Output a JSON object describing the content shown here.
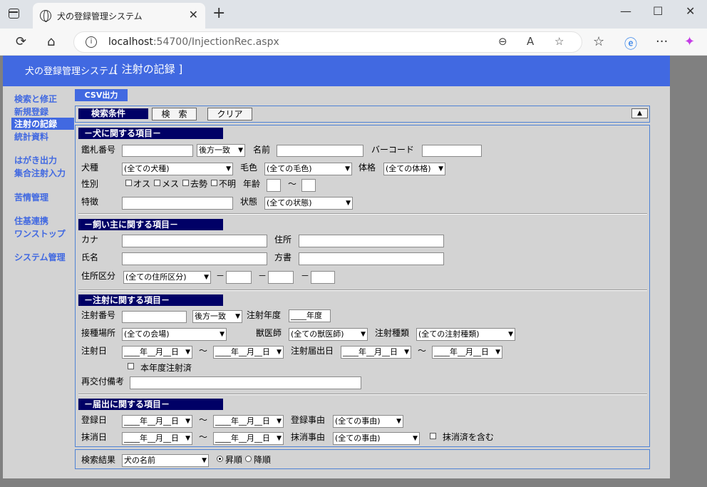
{
  "browser": {
    "tab_title": "犬の登録管理システム",
    "tab_close": "✕",
    "new_tab": "+",
    "url_host": "localhost",
    "url_rest": ":54700/InjectionRec.aspx",
    "win_min": "—",
    "win_max": "☐",
    "win_close": "✕"
  },
  "header": {
    "app_name": "犬の登録管理システム",
    "page_title": "[ 注射の記録 ]"
  },
  "sidebar": {
    "items": [
      {
        "label": "検索と修正"
      },
      {
        "label": "新規登録"
      },
      {
        "label": "注射の記録",
        "active": true
      },
      {
        "label": "統計資料"
      },
      {
        "label": "はがき出力"
      },
      {
        "label": "集合注射入力"
      },
      {
        "label": "苦情管理"
      },
      {
        "label": "住基連携"
      },
      {
        "label": "ワンストップ"
      },
      {
        "label": "システム管理"
      }
    ]
  },
  "toolbar": {
    "csv": "CSV出力"
  },
  "search": {
    "title": "検索条件",
    "search_button": "検　索",
    "clear_button": "クリア",
    "collapse": "▲"
  },
  "dog": {
    "heading": "－犬に関する項目－",
    "tag_label": "鑑札番号",
    "match_select": "後方一致",
    "name_label": "名前",
    "barcode_label": "バーコード",
    "breed_label": "犬種",
    "breed_select": "(全ての犬種)",
    "color_label": "毛色",
    "color_select": "(全ての毛色)",
    "body_label": "体格",
    "body_select": "(全ての体格)",
    "sex_label": "性別",
    "sex_male": "オス",
    "sex_female": "メス",
    "sex_neutered": "去勢",
    "sex_unknown": "不明",
    "age_label": "年齢",
    "age_tilde": "～",
    "feature_label": "特徴",
    "status_label": "状態",
    "status_select": "(全ての状態)"
  },
  "owner": {
    "heading": "－飼い主に関する項目－",
    "kana_label": "カナ",
    "address_label": "住所",
    "name_label": "氏名",
    "direction_label": "方書",
    "area_label": "住所区分",
    "area_select": "(全ての住所区分)",
    "dash": "－"
  },
  "injection": {
    "heading": "－注射に関する項目－",
    "number_label": "注射番号",
    "match_select": "後方一致",
    "year_label": "注射年度",
    "year_value": "____年度",
    "venue_label": "接種場所",
    "venue_select": "(全ての会場)",
    "vet_label": "獣医師",
    "vet_select": "(全ての獣医師)",
    "type_label": "注射種類",
    "type_select": "(全ての注射種類)",
    "date_label": "注射日",
    "date_value": "____年__月__日",
    "tilde": "～",
    "report_date_label": "注射届出日",
    "this_year_label": "本年度注射済",
    "reissue_label": "再交付備考"
  },
  "notice": {
    "heading": "－届出に関する項目－",
    "reg_date_label": "登録日",
    "date_value": "____年__月__日",
    "tilde": "～",
    "reg_reason_label": "登録事由",
    "reg_reason_select": "(全ての事由)",
    "del_date_label": "抹消日",
    "del_reason_label": "抹消事由",
    "del_reason_select": "(全ての事由)",
    "include_deleted_label": "抹消済を含む"
  },
  "results": {
    "label": "検索結果",
    "sort_select": "犬の名前",
    "asc": "昇順",
    "desc": "降順"
  }
}
